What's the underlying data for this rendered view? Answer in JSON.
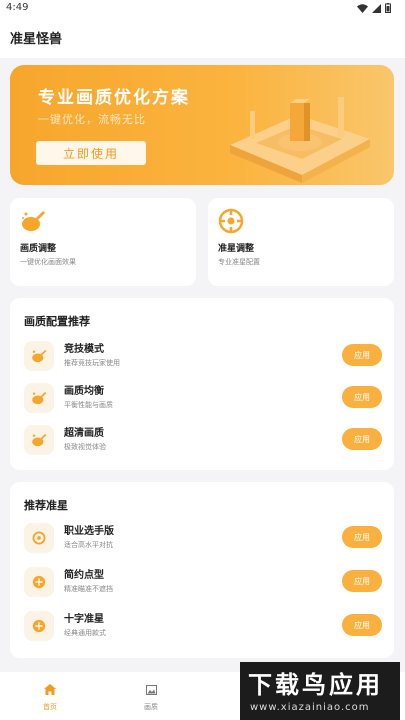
{
  "status_bar": {
    "time": "4:49"
  },
  "app": {
    "title": "准星怪兽"
  },
  "banner": {
    "title": "专业画质优化方案",
    "subtitle": "一键优化，流畅无比",
    "cta_label": "立即使用"
  },
  "quick_cards": [
    {
      "title": "画质调整",
      "desc": "一键优化画面效果",
      "icon": "paint-brush-icon"
    },
    {
      "title": "准星调整",
      "desc": "专业准星配置",
      "icon": "crosshair-icon"
    }
  ],
  "quality_section": {
    "title": "画质配置推荐",
    "items": [
      {
        "title": "竞技模式",
        "desc": "推荐竞技玩家使用",
        "button": "应用"
      },
      {
        "title": "画质均衡",
        "desc": "平衡性能与画质",
        "button": "应用"
      },
      {
        "title": "超清画质",
        "desc": "极致视觉体验",
        "button": "应用"
      }
    ]
  },
  "crosshair_section": {
    "title": "推荐准星",
    "items": [
      {
        "title": "职业选手版",
        "desc": "适合高水平对抗",
        "button": "应用"
      },
      {
        "title": "简约点型",
        "desc": "精准瞄准不遮挡",
        "button": "应用"
      },
      {
        "title": "十字准星",
        "desc": "经典通用款式",
        "button": "应用"
      }
    ]
  },
  "tabbar": {
    "home": "首页",
    "gallery": "画质"
  },
  "watermark": {
    "main": "下载鸟应用",
    "url": "www.xiazainiao.com"
  },
  "colors": {
    "accent": "#f9b03e",
    "background": "#f4f4f6"
  }
}
